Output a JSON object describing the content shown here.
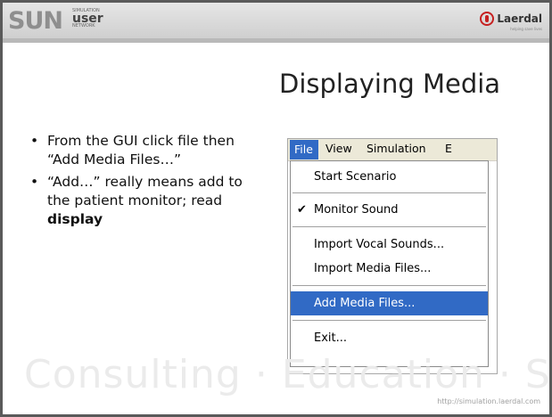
{
  "header": {
    "logo_main": "SUN",
    "logo_small_top": "SIMULATION",
    "logo_user": "user",
    "logo_small_bottom": "NETWORK",
    "brand": "Laerdal",
    "brand_tagline": "helping save lives"
  },
  "slide": {
    "title": "Displaying Media",
    "bullets": [
      {
        "text": "From the GUI click file then “Add Media Files…”"
      },
      {
        "text": "“Add…” really means add to the patient monitor; read ",
        "bold": "display"
      }
    ]
  },
  "menu": {
    "bar": [
      "File",
      "View",
      "Simulation",
      "E"
    ],
    "items": [
      {
        "label": "Start Scenario",
        "checked": false,
        "highlighted": false
      },
      {
        "label": "Monitor Sound",
        "checked": true,
        "highlighted": false
      },
      {
        "label": "Import Vocal Sounds...",
        "checked": false,
        "highlighted": false
      },
      {
        "label": "Import Media Files...",
        "checked": false,
        "highlighted": false
      },
      {
        "label": "Add Media Files...",
        "checked": false,
        "highlighted": true
      },
      {
        "label": "Exit...",
        "checked": false,
        "highlighted": false
      }
    ],
    "check_glyph": "✔"
  },
  "footer": {
    "watermark": "Consulting  ·  Education  ·  Support",
    "url": "http://simulation.laerdal.com"
  },
  "colors": {
    "highlight": "#316ac5",
    "menubar_bg": "#ece9d8",
    "laerdal_red": "#c62020"
  }
}
